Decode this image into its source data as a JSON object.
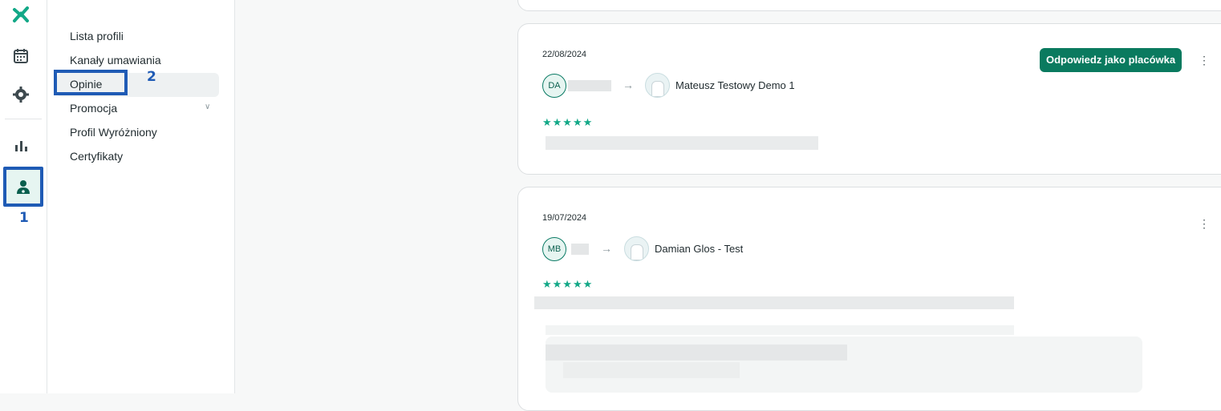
{
  "rail": {
    "icons": [
      "logo-icon",
      "calendar-icon",
      "gear-icon",
      "bar-chart-icon",
      "doctor-icon"
    ],
    "marker": "1"
  },
  "submenu": {
    "items": [
      {
        "label": "Lista profili"
      },
      {
        "label": "Kanały umawiania"
      },
      {
        "label": "Opinie"
      },
      {
        "label": "Promocja"
      },
      {
        "label": "Profil Wyróżniony"
      },
      {
        "label": "Certyfikaty"
      }
    ],
    "selected": "Opinie",
    "marker": "2"
  },
  "reviews": [
    {
      "date": "22/08/2024",
      "author_initials": "DA",
      "doctor_name": "Mateusz Testowy Demo 1",
      "stars": "★★★★★",
      "rating": 5,
      "reply_label": "Odpowiedz jako placówka",
      "menu": "⋮"
    },
    {
      "date": "19/07/2024",
      "author_initials": "MB",
      "doctor_name": "Damian Glos - Test",
      "stars": "★★★★★",
      "rating": 5,
      "menu": "⋮"
    }
  ],
  "colors": {
    "accent": "#0a7a5f",
    "highlight": "#1f5bb5",
    "star": "#12a887"
  }
}
